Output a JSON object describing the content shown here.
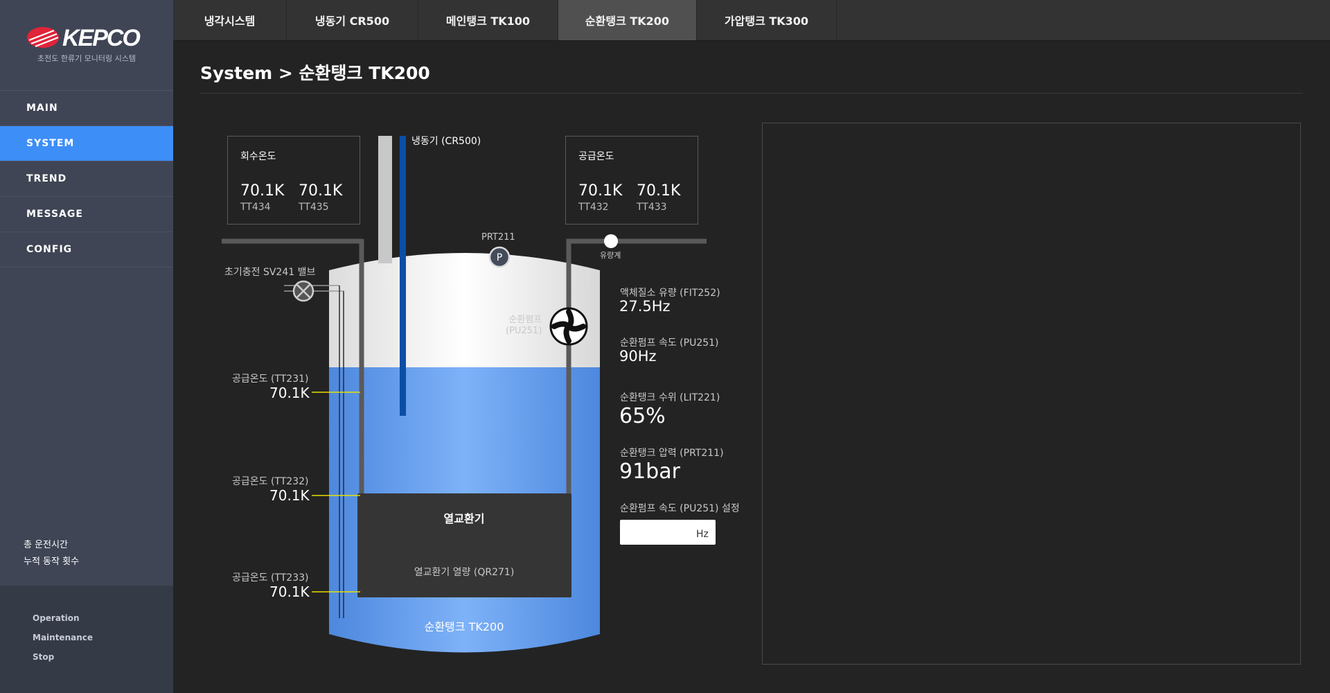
{
  "brand": {
    "logo_text": "KEPCO",
    "subtitle": "초전도 한류기 모니터링 시스템",
    "color": "#e0243a"
  },
  "sidebar": {
    "items": [
      {
        "label": "MAIN",
        "active": false
      },
      {
        "label": "SYSTEM",
        "active": true
      },
      {
        "label": "TREND",
        "active": false
      },
      {
        "label": "MESSAGE",
        "active": false
      },
      {
        "label": "CONFIG",
        "active": false
      }
    ],
    "stats": [
      "총 운전시간",
      "누적 동작 횟수"
    ],
    "modes": [
      "Operation",
      "Maintenance",
      "Stop"
    ]
  },
  "tabs": [
    {
      "label": "냉각시스템",
      "active": false
    },
    {
      "label": "냉동기 CR500",
      "active": false
    },
    {
      "label": "메인탱크 TK100",
      "active": false
    },
    {
      "label": "순환탱크 TK200",
      "active": true
    },
    {
      "label": "가압탱크 TK300",
      "active": false
    }
  ],
  "page_title": "System > 순환탱크 TK200",
  "diagram": {
    "return_temp": {
      "title": "회수온도",
      "readings": [
        {
          "value": "70.1K",
          "tag": "TT434"
        },
        {
          "value": "70.1K",
          "tag": "TT435"
        }
      ]
    },
    "supply_temp": {
      "title": "공급온도",
      "readings": [
        {
          "value": "70.1K",
          "tag": "TT432"
        },
        {
          "value": "70.1K",
          "tag": "TT433"
        }
      ]
    },
    "chiller_label": "냉동기 (CR500)",
    "prt_label": "PRT211",
    "prt_symbol": "P",
    "flowmeter_label": "유량계",
    "valve_label": "초기충전 SV241 밸브",
    "pump_label": [
      "순환펌프",
      "(PU251)"
    ],
    "side_temps": [
      {
        "label": "공급온도 (TT231)",
        "value": "70.1K"
      },
      {
        "label": "공급온도 (TT232)",
        "value": "70.1K"
      },
      {
        "label": "공급온도 (TT233)",
        "value": "70.1K"
      }
    ],
    "heat_exchanger": {
      "title": "열교환기",
      "subtitle": "열교환기 열량 (QR271)"
    },
    "tank_label": "순환탱크 TK200",
    "colors": {
      "liquid": "#6ea6f2",
      "tank_top": "#efefef",
      "exchanger": "#353535",
      "chiller_rod": "#0b4ea6",
      "temp_line": "#e8e000"
    }
  },
  "metrics": [
    {
      "label": "액체질소 유량 (FIT252)",
      "value": "27.5Hz"
    },
    {
      "label": "순환펌프 속도 (PU251)",
      "value": "90Hz"
    },
    {
      "label": "순환탱크 수위 (LIT221)",
      "value": "65%"
    },
    {
      "label": "순환탱크 압력 (PRT211)",
      "value": "91bar"
    }
  ],
  "pump_speed_setting": {
    "label": "순환펌프 속도 (PU251) 설정",
    "value": "",
    "unit": "Hz"
  }
}
